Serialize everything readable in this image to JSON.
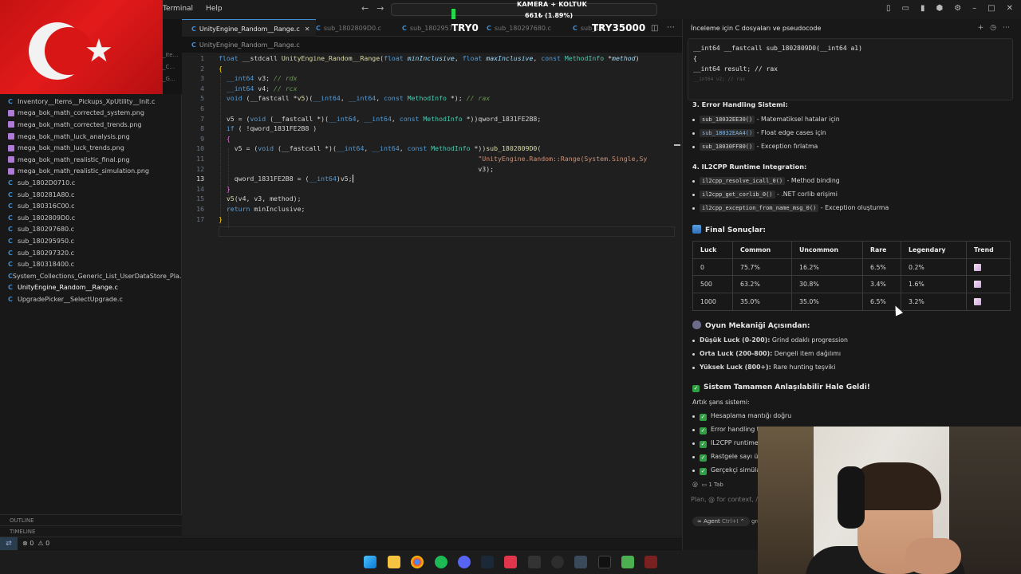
{
  "titlebar": {
    "menu": [
      "Terminal",
      "Help"
    ],
    "overlay_line1": "KAMERA + KOLTUK",
    "overlay_line2": "661₺ (1.89%)"
  },
  "tabs": [
    {
      "label": "UnityEngine_Random__Range.c",
      "active": true
    },
    {
      "label": "sub_1802809D0.c",
      "active": false
    },
    {
      "label": "sub_1802957...",
      "active": false
    },
    {
      "label": "sub_180297680.c",
      "active": false
    },
    {
      "label": "sub_18...",
      "active": false
    }
  ],
  "overlays": {
    "try0": "TRY0",
    "try35000": "TRY35000"
  },
  "breadcrumb": "UnityEngine_Random__Range.c",
  "sidebar": {
    "edge_texts": [
      "_Ite...",
      "_C...",
      "_G..."
    ],
    "files": [
      "Inventory__Items__Pickups_XpUtility__Init.c",
      "mega_bok_math_corrected_system.png",
      "mega_bok_math_corrected_trends.png",
      "mega_bok_math_luck_analysis.png",
      "mega_bok_math_luck_trends.png",
      "mega_bok_math_realistic_final.png",
      "mega_bok_math_realistic_simulation.png",
      "sub_1802D0710.c",
      "sub_180281A80.c",
      "sub_180316C00.c",
      "sub_1802809D0.c",
      "sub_180297680.c",
      "sub_180295950.c",
      "sub_180297320.c",
      "sub_180318400.c",
      "System_Collections_Generic_List_UserDataStore_Pla...",
      "UnityEngine_Random__Range.c",
      "UpgradePicker__SelectUpgrade.c"
    ],
    "outline_label": "OUTLINE",
    "timeline_label": "TIMELINE"
  },
  "status": {
    "errors": "0",
    "warnings": "0"
  },
  "editor": {
    "line_numbers": [
      "1",
      "2",
      "3",
      "4",
      "5",
      "6",
      "7",
      "8",
      "9",
      "10",
      "11",
      "12",
      "13",
      "14",
      "15",
      "16",
      "17"
    ]
  },
  "chat": {
    "header": "İnceleme için C dosyaları ve pseudocode",
    "code_block": [
      "__int64 __fastcall sub_1802809D0(__int64 a1)",
      "{",
      "  __int64 result; // rax",
      "  __int64 v2; // rax"
    ],
    "section3": {
      "title": "3. Error Handling Sistemi:",
      "items": [
        {
          "code": "sub_18032EE30()",
          "text": " - Matematiksel hatalar için"
        },
        {
          "code": "sub_18032EAA4()",
          "text": " - Float edge cases için"
        },
        {
          "code": "sub_18030FF80()",
          "text": " - Exception fırlatma"
        }
      ]
    },
    "section4": {
      "title": "4. IL2CPP Runtime Integration:",
      "items": [
        {
          "code": "il2cpp_resolve_icall_0()",
          "text": " - Method binding"
        },
        {
          "code": "il2cpp_get_corlib_0()",
          "text": " - .NET corlib erişimi"
        },
        {
          "code": "il2cpp_exception_from_name_msg_0()",
          "text": " - Exception oluşturma"
        }
      ]
    },
    "final_title": "Final Sonuçlar:",
    "table": {
      "headers": [
        "Luck",
        "Common",
        "Uncommon",
        "Rare",
        "Legendary",
        "Trend"
      ],
      "rows": [
        [
          "0",
          "75.7%",
          "16.2%",
          "6.5%",
          "0.2%"
        ],
        [
          "500",
          "63.2%",
          "30.8%",
          "3.4%",
          "1.6%"
        ],
        [
          "1000",
          "35.0%",
          "35.0%",
          "6.5%",
          "3.2%"
        ]
      ]
    },
    "game_title": "Oyun Mekaniği Açısından:",
    "game_items": [
      {
        "bold": "Düşük Luck (0-200):",
        "text": " Grind odaklı progression"
      },
      {
        "bold": "Orta Luck (200-800):",
        "text": " Dengeli item dağılımı"
      },
      {
        "bold": "Yüksek Luck (800+):",
        "text": " Rare hunting teşviki"
      }
    ],
    "done_title": "Sistem Tamamen Anlaşılabilir Hale Geldi!",
    "luck_intro": "Artık şans sistemi:",
    "check_items": [
      "Hesaplama mantığı doğru",
      "Error handling t...",
      "IL2CPP runtime...",
      "Rastgele sayı ür...",
      "Gerçekçi simülas..."
    ],
    "footer_tab": "1 Tab",
    "input_placeholder": "Plan, @ for context, / fo...",
    "agent_label": "Agent",
    "agent_shortcut": "Ctrl+I",
    "agent_extra": "gro..."
  },
  "colors": {
    "accent": "#3f8ed8",
    "check": "#2ea043",
    "cmd_green": "#26d94c"
  }
}
